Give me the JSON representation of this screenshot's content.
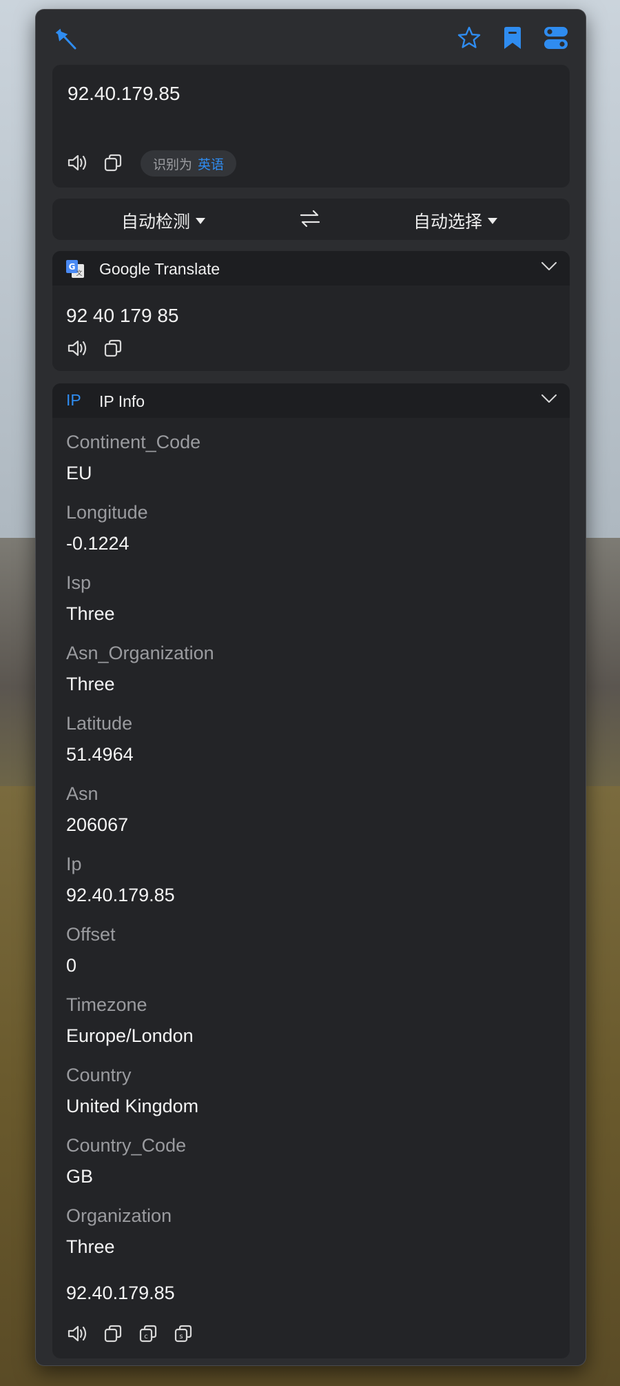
{
  "colors": {
    "accent": "#2f8cf0",
    "panel": "#2c2d30",
    "card": "#232427",
    "header": "#1d1e21"
  },
  "toolbar": {
    "pin_icon": "pin-icon",
    "favorite_icon": "star-icon",
    "bookmark_icon": "bookmark-icon",
    "settings_icon": "toggle-settings-icon"
  },
  "input": {
    "text": "92.40.179.85",
    "detected_prefix": "识别为",
    "detected_language": "英语"
  },
  "language_bar": {
    "source": "自动检测",
    "target": "自动选择"
  },
  "google": {
    "title": "Google Translate",
    "result": "92 40 179 85"
  },
  "ipinfo": {
    "badge": "IP",
    "title": "IP Info",
    "fields": [
      {
        "key": "Continent_Code",
        "value": "EU"
      },
      {
        "key": "Longitude",
        "value": "-0.1224"
      },
      {
        "key": "Isp",
        "value": "Three"
      },
      {
        "key": "Asn_Organization",
        "value": "Three"
      },
      {
        "key": "Latitude",
        "value": "51.4964"
      },
      {
        "key": "Asn",
        "value": "206067"
      },
      {
        "key": "Ip",
        "value": "92.40.179.85"
      },
      {
        "key": "Offset",
        "value": "0"
      },
      {
        "key": "Timezone",
        "value": "Europe/London"
      },
      {
        "key": "Country",
        "value": "United Kingdom"
      },
      {
        "key": "Country_Code",
        "value": "GB"
      },
      {
        "key": "Organization",
        "value": "Three"
      }
    ],
    "footer_ip": "92.40.179.85"
  }
}
